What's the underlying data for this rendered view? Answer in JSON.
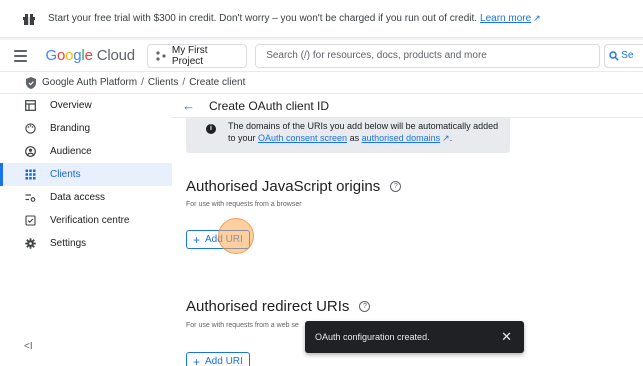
{
  "banner": {
    "text": "Start your free trial with $300 in credit. Don't worry – you won't be charged if you run out of credit.",
    "link": "Learn more"
  },
  "header": {
    "logo_google": "Google",
    "logo_cloud": "Cloud",
    "project": "My First Project",
    "search_placeholder": "Search (/) for resources, docs, products and more",
    "search_button": "Se"
  },
  "breadcrumb": {
    "items": [
      "Google Auth Platform",
      "Clients",
      "Create client"
    ],
    "separator": "/"
  },
  "sidebar": {
    "items": [
      {
        "label": "Overview",
        "icon": "dashboard-icon"
      },
      {
        "label": "Branding",
        "icon": "palette-icon"
      },
      {
        "label": "Audience",
        "icon": "person-icon"
      },
      {
        "label": "Clients",
        "icon": "grid-icon"
      },
      {
        "label": "Data access",
        "icon": "tune-icon"
      },
      {
        "label": "Verification centre",
        "icon": "check-box-icon"
      },
      {
        "label": "Settings",
        "icon": "gear-icon"
      }
    ],
    "active_index": 3,
    "collapse_label": "<I"
  },
  "main": {
    "back_icon": "←",
    "title": "Create OAuth client ID",
    "info": {
      "line1": "The domains of the URIs you add below will be automatically added",
      "line2_prefix": "to your ",
      "link1": "OAuth consent screen",
      "mid": " as ",
      "link2": "authorised domains",
      "suffix": "."
    },
    "js_origins": {
      "title": "Authorised JavaScript origins",
      "subtitle": "For use with requests from a browser",
      "add_label": "Add URI"
    },
    "redirect": {
      "title": "Authorised redirect URIs",
      "subtitle": "For use with requests from a web se",
      "add_label": "Add URI"
    }
  },
  "toast": {
    "message": "OAuth configuration created.",
    "close": "✕"
  },
  "colors": {
    "accent": "#1a73e8",
    "active_bg": "#e8f0fe",
    "toast_bg": "#202124",
    "click_marker": "#fba854"
  }
}
